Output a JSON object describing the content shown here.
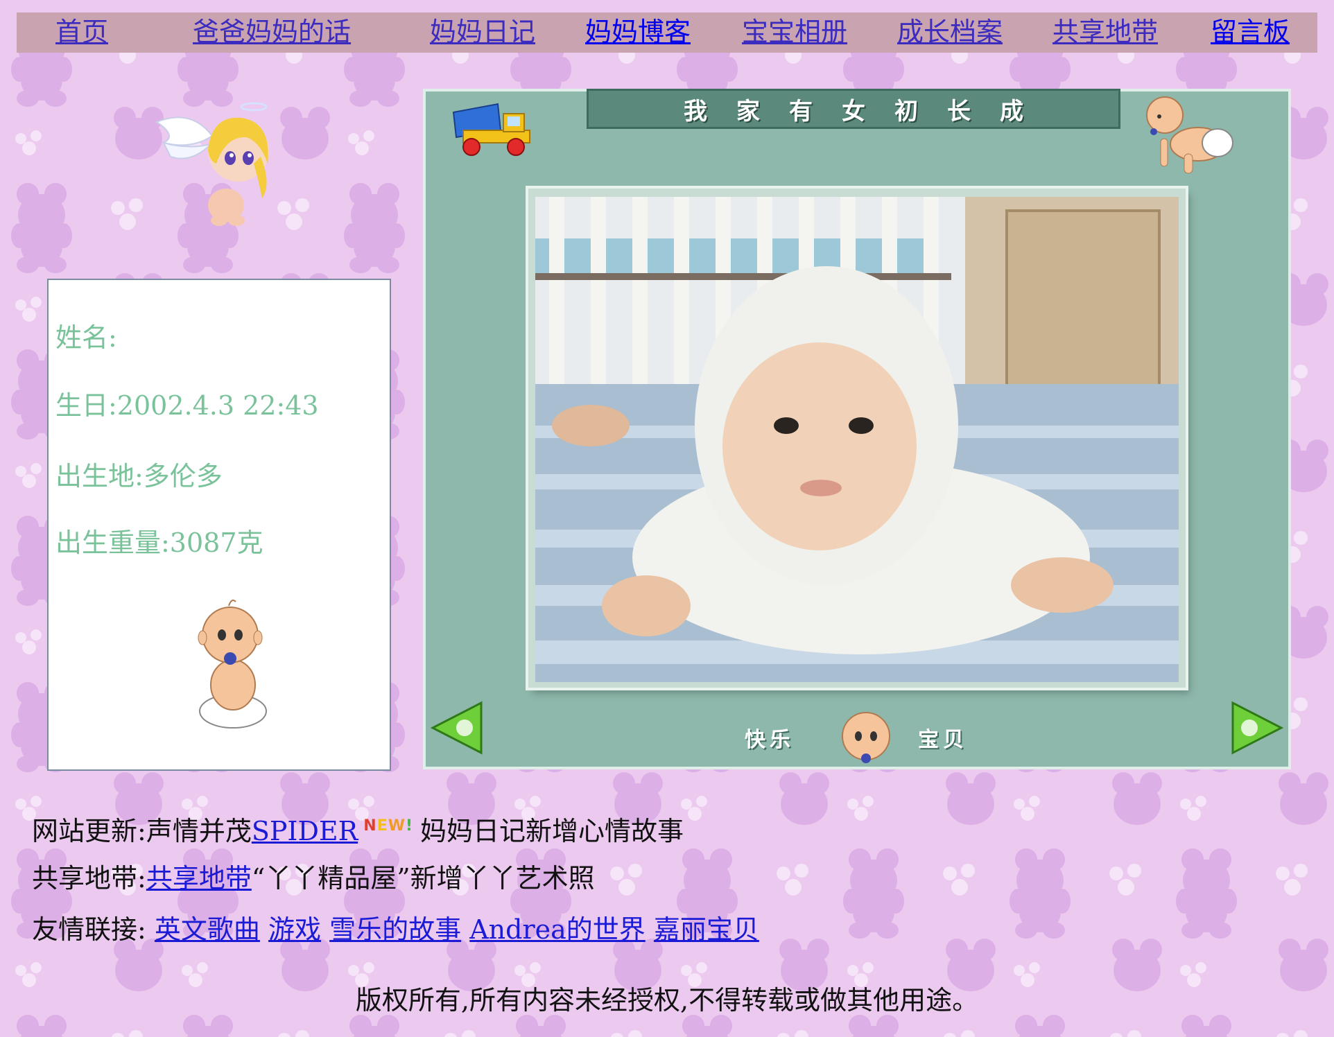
{
  "nav": {
    "items": [
      {
        "label": "首页"
      },
      {
        "label": "爸爸妈妈的话"
      },
      {
        "label": "妈妈日记"
      },
      {
        "label": "妈妈博客"
      },
      {
        "label": "宝宝相册"
      },
      {
        "label": "成长档案"
      },
      {
        "label": "共享地带"
      },
      {
        "label": "留言板"
      }
    ]
  },
  "profile": {
    "name_label": "姓名:",
    "birthday": "生日:2002.4.3 22:43",
    "birthplace": "出生地:多伦多",
    "birth_weight": "出生重量:3087克"
  },
  "banner": {
    "title": "我家有女初长成",
    "caption_left": "快乐",
    "caption_right": "宝贝"
  },
  "updates": {
    "site_label": "网站更新:",
    "site_text_prefix": "声情并茂",
    "site_link": "SPIDER",
    "new_badge": "NEW!",
    "site_text_suffix": "妈妈日记新增心情故事",
    "share_label": "共享地带:",
    "share_link": "共享地带",
    "share_text": "“丫丫精品屋”新增丫丫艺术照",
    "friends_label": "友情联接:",
    "friend_links": [
      "英文歌曲",
      "游戏",
      "雪乐的故事",
      "Andrea的世界",
      "嘉丽宝贝"
    ]
  },
  "footer": {
    "copyright": "版权所有,所有内容未经授权,不得转载或做其他用途。"
  },
  "colors": {
    "background": "#ecc9ef",
    "nav_bar": "#c9a3b0",
    "frame": "#8fb8ac",
    "info_text": "#79c29a",
    "link": "#1b1bd6"
  }
}
